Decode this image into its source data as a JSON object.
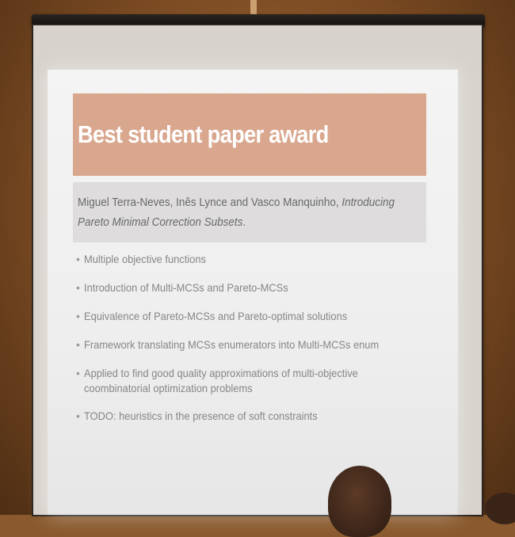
{
  "slide": {
    "title": "Best student paper award",
    "authors_plain": "Miguel Terra-Neves, Inês Lynce and Vasco Manquinho, ",
    "paper_title": "Introducing Pareto Minimal Correction Subsets",
    "paper_title_end": ".",
    "bullet_marker": "•",
    "bullets": [
      "Multiple objective functions",
      "Introduction of Multi-MCSs and Pareto-MCSs",
      "Equivalence of Pareto-MCSs and Pareto-optimal solutions",
      "Framework translating MCSs enumerators into Multi-MCSs enum",
      "Applied to find good quality approximations of multi-objective coombinatorial optimization problems",
      "TODO: heuristics in the presence of soft constraints"
    ]
  },
  "colors": {
    "title_band": "#d9a78e",
    "authors_band": "#dedcdd",
    "slide_background": "#f0f0f0",
    "wall": "#8a5a2e"
  }
}
